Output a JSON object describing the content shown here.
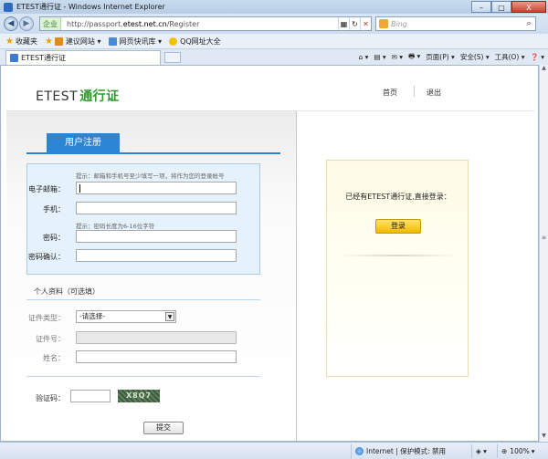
{
  "window": {
    "title": "ETEST通行证 - Windows Internet Explorer",
    "min_label": "–",
    "max_label": "□",
    "close_label": "X"
  },
  "addressbar": {
    "secure_label": "企业",
    "url_prefix": "http://passport.",
    "url_domain": "etest.net.cn",
    "url_suffix": "/Register",
    "refresh_icon": "↻",
    "stop_icon": "✕",
    "search_placeholder": "Bing",
    "search_go": "⌕"
  },
  "favorites": {
    "favorites_label": "收藏夹",
    "items": [
      "建议网站 ▾",
      "网页快讯库 ▾",
      "QQ网址大全"
    ]
  },
  "tabs": {
    "active_tab": "ETEST通行证",
    "commands": [
      "⌂ ▾",
      "▤ ▾",
      "✉ ▾",
      "🖶 ▾",
      "页面(P) ▾",
      "安全(S) ▾",
      "工具(O) ▾",
      "❓ ▾"
    ]
  },
  "header": {
    "logo_text": "ETEST",
    "logo_highlight": "通行证",
    "nav_home": "首页",
    "nav_logout": "退出"
  },
  "register": {
    "tab_label": "用户注册",
    "hint_contact": "提示：邮箱和手机号至少填写一项，将作为您的登录帐号",
    "email_label": "电子邮箱：",
    "phone_label": "手机：",
    "hint_password": "提示：密码长度为6-16位字符",
    "password_label": "密码：",
    "password_confirm_label": "密码确认：",
    "profile_section": "个人资料（可选填）",
    "id_type_label": "证件类型：",
    "id_type_selected": "-请选择-",
    "id_number_label": "证件号：",
    "name_label": "姓名：",
    "captcha_label": "验证码：",
    "captcha_image_text": "X8Q7",
    "submit_label": "提交"
  },
  "login_panel": {
    "message": "已经有ETEST通行证,直接登录：",
    "login_button": "登录"
  },
  "statusbar": {
    "zone": "Internet | 保护模式: 禁用",
    "zoom": "100%"
  }
}
